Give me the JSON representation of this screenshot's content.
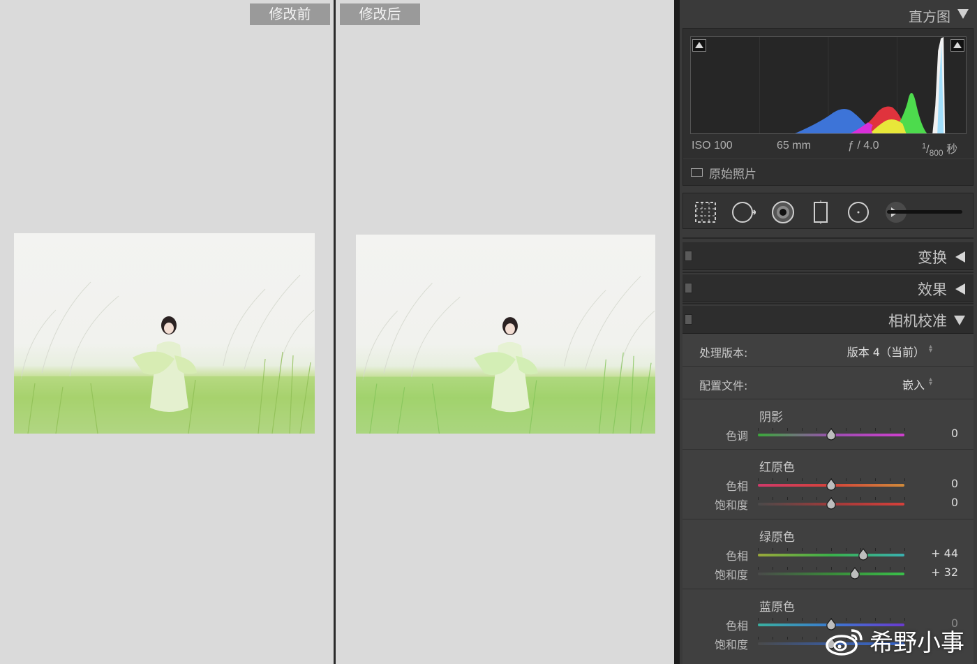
{
  "compare": {
    "before_label": "修改前",
    "after_label": "修改后"
  },
  "histogram": {
    "title": "直方图",
    "iso": "ISO 100",
    "focal": "65 mm",
    "aperture": "ƒ / 4.0",
    "shutter_num": "1",
    "shutter_den": "800",
    "shutter_unit": "秒",
    "original_photo_label": "原始照片"
  },
  "sections": {
    "transform": "变换",
    "effects": "效果",
    "calibration": "相机校准"
  },
  "calibration": {
    "process_label": "处理版本:",
    "process_value": "版本 4（当前）",
    "profile_label": "配置文件:",
    "profile_value": "嵌入",
    "shadows": {
      "title": "阴影",
      "tint_label": "色调",
      "tint_value": "0",
      "tint": 0
    },
    "red": {
      "title": "红原色",
      "hue_label": "色相",
      "hue_value": "0",
      "hue": 0,
      "sat_label": "饱和度",
      "sat_value": "0",
      "sat": 0
    },
    "green": {
      "title": "绿原色",
      "hue_label": "色相",
      "hue_value": "+ 44",
      "hue": 44,
      "sat_label": "饱和度",
      "sat_value": "+ 32",
      "sat": 32
    },
    "blue": {
      "title": "蓝原色",
      "hue_label": "色相",
      "hue_value": "0",
      "hue": 0,
      "sat_label": "饱和度",
      "sat_value": "0",
      "sat": 0
    }
  },
  "watermark": "希野小事",
  "colors": {
    "panel_bg": "#3a3a3a",
    "compare_bg": "#dadada",
    "label_bg": "#9a9a9a"
  }
}
